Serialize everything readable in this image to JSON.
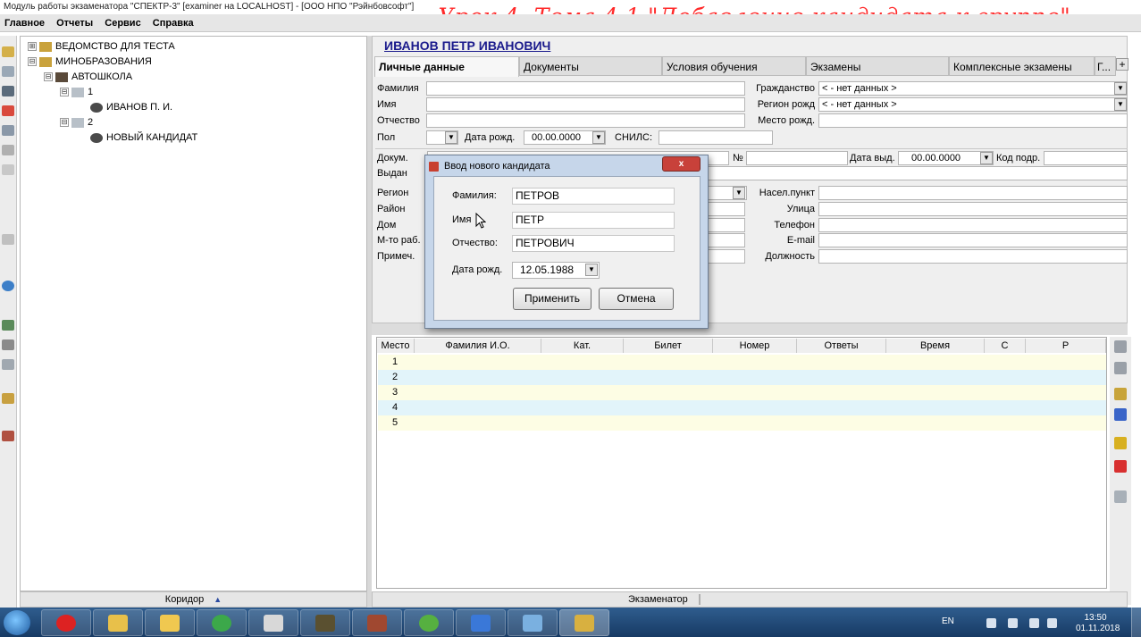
{
  "window": {
    "title": "Модуль работы экзаменатора \"СПЕКТР-3\" [examiner на LOCALHOST] - [ООО НПО \"Рэйнбовсофт\"]"
  },
  "lesson_overlay": "Урок 4. Тема 4.1 \"Добавление кандидата к группе\"",
  "menu": {
    "items": [
      "Главное",
      "Отчеты",
      "Сервис",
      "Справка"
    ]
  },
  "tree": {
    "nodes": [
      "ВЕДОМСТВО ДЛЯ ТЕСТА",
      "МИНОБРАЗОВАНИЯ",
      "АВТОШКОЛА",
      "1",
      "ИВАНОВ П. И.",
      "2",
      "НОВЫЙ КАНДИДАТ"
    ],
    "expanders": [
      "⊞",
      "⊟",
      "⊟",
      "⊟",
      "⊟"
    ],
    "footer": "Коридор",
    "footer_arrow": "▲"
  },
  "candidate": {
    "name": "ИВАНОВ ПЕТР ИВАНОВИЧ"
  },
  "tabs": [
    "Личные данные",
    "Документы",
    "Условия обучения",
    "Экзамены",
    "Комплексные экзамены",
    "Г..."
  ],
  "form": {
    "labels": {
      "lastname": "Фамилия",
      "firstname": "Имя",
      "patronymic": "Отчество",
      "sex": "Пол",
      "birthdate": "Дата рожд.",
      "snils": "СНИЛС:",
      "citizenship": "Гражданство",
      "birth_region": "Регион рожд",
      "birth_place": "Место рожд.",
      "doc": "Докум.",
      "issued_by": "Выдан",
      "doc_no": "№",
      "issue_date": "Дата выд.",
      "dept_code": "Код подр.",
      "region": "Регион",
      "district": "Район",
      "house": "Дом",
      "workplace": "М-то раб.",
      "note": "Примеч.",
      "settlement": "Насел.пункт",
      "street": "Улица",
      "phone": "Телефон",
      "email": "E-mail",
      "position": "Должность"
    },
    "values": {
      "birthdate": "00.00.0000",
      "citizenship": "< - нет данных >",
      "birth_region": "< - нет данных >",
      "issue_date": "00.00.0000"
    }
  },
  "dialog": {
    "title": "Ввод нового кандидата",
    "close_glyph": "x",
    "labels": {
      "lastname": "Фамилия:",
      "firstname": "Имя",
      "patronymic": "Отчество:",
      "birthdate": "Дата рожд."
    },
    "values": {
      "lastname": "ПЕТРОВ",
      "firstname": "ПЕТР",
      "patronymic": "ПЕТРОВИЧ",
      "birthdate": "12.05.1988"
    },
    "buttons": {
      "apply": "Применить",
      "cancel": "Отмена"
    }
  },
  "grid": {
    "columns": [
      "Место",
      "Фамилия И.О.",
      "Кат.",
      "Билет",
      "Номер",
      "Ответы",
      "Время",
      "С",
      "Р"
    ],
    "rows": [
      "1",
      "2",
      "3",
      "4",
      "5"
    ]
  },
  "status": {
    "examiner": "Экзаменатор"
  },
  "taskbar": {
    "lang": "EN",
    "time": "13:50",
    "date": "01.11.2018"
  },
  "colors": {
    "accent": "#1a1a8c",
    "overlay": "#ff2a2a",
    "row_a": "#fdfde4",
    "row_b": "#e2f4fa"
  }
}
